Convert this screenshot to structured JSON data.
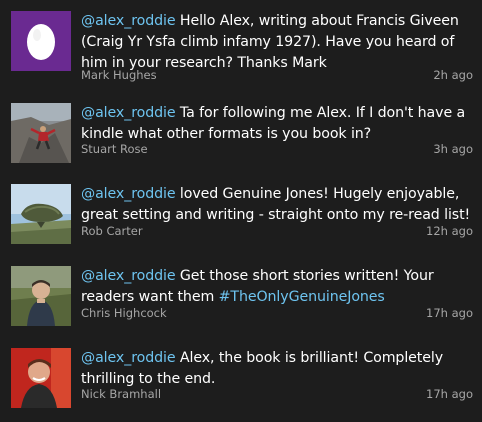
{
  "colors": {
    "background": "#1d1d1d",
    "text": "#ffffff",
    "link": "#6ec4f0",
    "meta": "#a6a6a6"
  },
  "tweets": [
    {
      "avatar_icon": "default-egg-avatar",
      "mention": "@alex_roddie",
      "text": " Hello Alex, writing about Francis Giveen (Craig Yr Ysfa climb infamy 1927). Have you heard of him in your research? Thanks Mark",
      "hashtag": "",
      "text_after": "",
      "author": "Mark Hughes",
      "time": "2h ago"
    },
    {
      "avatar_icon": "rock-climber-avatar",
      "mention": "@alex_roddie",
      "text": " Ta for following me Alex. If I don't have a kindle what other formats is you book in?",
      "hashtag": "",
      "text_after": "",
      "author": "Stuart Rose",
      "time": "3h ago"
    },
    {
      "avatar_icon": "boulder-landscape-avatar",
      "mention": "@alex_roddie",
      "text": " loved Genuine Jones! Hugely enjoyable, great setting and writing - straight onto my re-read list!",
      "hashtag": "",
      "text_after": "",
      "author": "Rob Carter",
      "time": "12h ago"
    },
    {
      "avatar_icon": "person-outdoors-avatar",
      "mention": "@alex_roddie",
      "text": " Get those short stories written!  Your readers want them ",
      "hashtag": "#TheOnlyGenuineJones",
      "text_after": "",
      "author": "Chris Highcock",
      "time": "17h ago"
    },
    {
      "avatar_icon": "person-red-background-avatar",
      "mention": "@alex_roddie",
      "text": " Alex, the book is brilliant! Completely thrilling to the end.",
      "hashtag": "",
      "text_after": "",
      "author": "Nick Bramhall",
      "time": "17h ago"
    }
  ]
}
